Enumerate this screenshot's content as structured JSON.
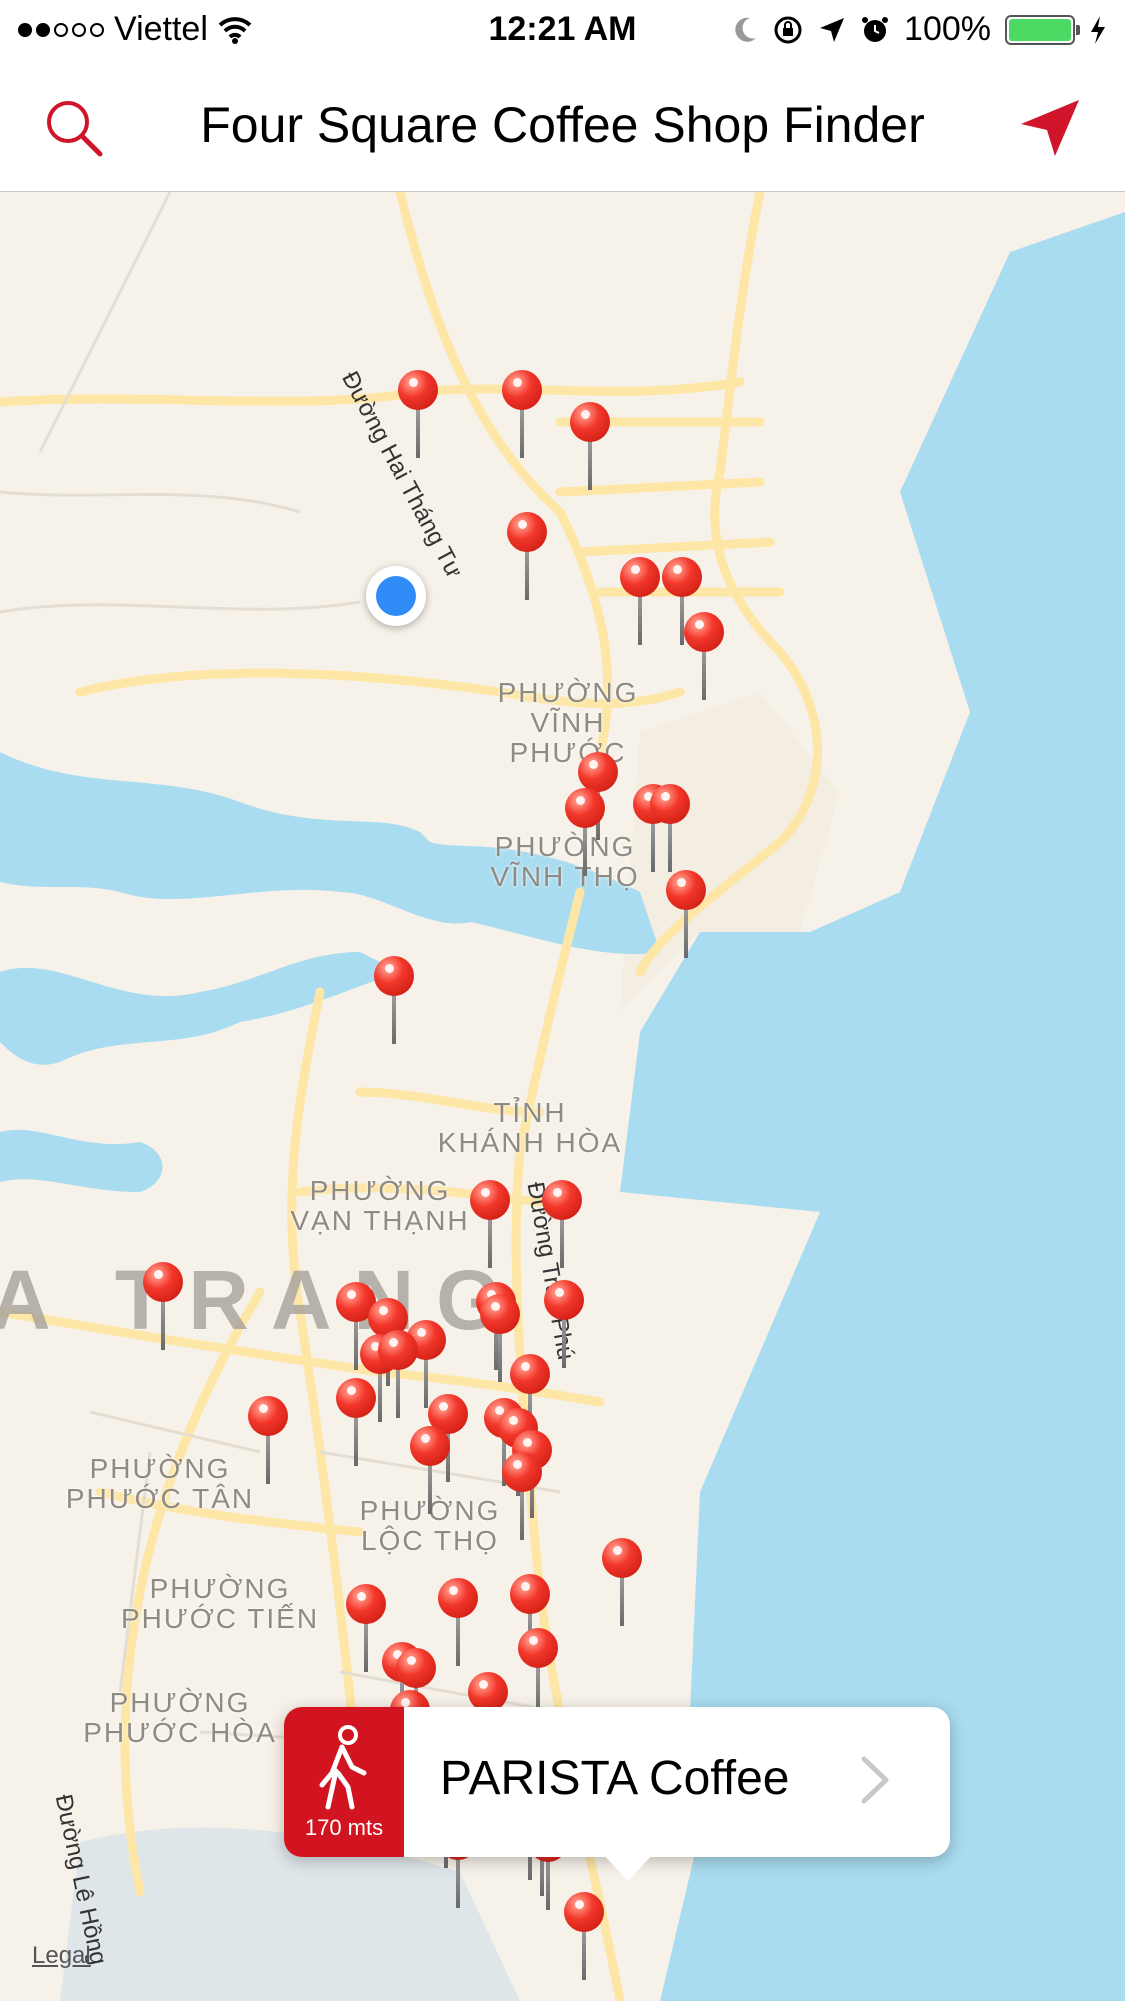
{
  "status_bar": {
    "carrier": "Viettel",
    "time": "12:21 AM",
    "battery": "100%",
    "signal_bars_filled": 2,
    "signal_bars_total": 5,
    "icons": [
      "wifi-icon",
      "moon-icon",
      "rotation-lock-icon",
      "location-arrow-icon",
      "alarm-icon",
      "battery-icon",
      "charging-bolt-icon"
    ]
  },
  "navbar": {
    "title": "Four Square Coffee Shop Finder",
    "left_icon": "search-icon",
    "right_icon": "location-arrow-icon",
    "accent": "#d0142a"
  },
  "map": {
    "districts": [
      {
        "line1": "PHƯỜNG",
        "line2": "VĨNH PHƯỚC"
      },
      {
        "line1": "PHƯỜNG",
        "line2": "VĨNH THỌ"
      },
      {
        "line1": "TỈNH",
        "line2": "KHÁNH HÒA"
      },
      {
        "line1": "PHƯỜNG",
        "line2": "VẠN THẠNH"
      },
      {
        "line1": "PHƯỜNG",
        "line2": "PHƯỚC TÂN"
      },
      {
        "line1": "PHƯỜNG",
        "line2": "LỘC THỌ"
      },
      {
        "line1": "PHƯỜNG",
        "line2": "PHƯỚC TIẾN"
      },
      {
        "line1": "PHƯỜNG",
        "line2": "PHƯỚC HÒA"
      }
    ],
    "city": "A TRANG",
    "streets": [
      "Đường Hai Tháng Tư",
      "Đường Trần Phú",
      "Đường Lê Hồng"
    ],
    "legal": "Legal",
    "pin_color": "#f2362a",
    "user_location_color": "#2f8cf7",
    "water_color": "#a9dcf0",
    "land_color": "#f7f2e9",
    "road_color": "#fde6a6"
  },
  "callout": {
    "name": "PARISTA Coffee",
    "distance": "170 mts",
    "icon": "walking-person-icon",
    "accent": "#d1141f"
  }
}
